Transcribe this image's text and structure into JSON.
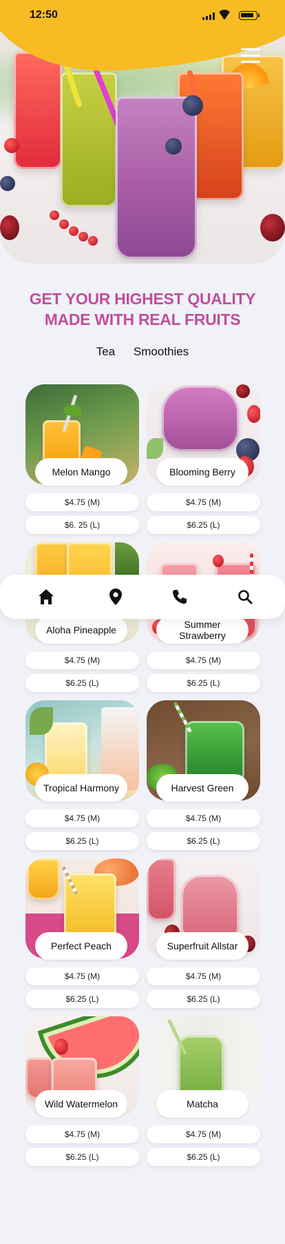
{
  "status_bar": {
    "time": "12:50"
  },
  "headline": {
    "line1": "GET YOUR HIGHEST QUALITY",
    "line2": "MADE WITH REAL FRUITS"
  },
  "categories": [
    "Tea",
    "Smoothies"
  ],
  "products": [
    {
      "name": "Melon Mango",
      "price_m": "$4.75 (M)",
      "price_l": "$6. 25 (L)"
    },
    {
      "name": "Blooming Berry",
      "price_m": "$4.75 (M)",
      "price_l": "$6.25 (L)"
    },
    {
      "name": "Aloha Pineapple",
      "price_m": "$4.75 (M)",
      "price_l": "$6.25 (L)"
    },
    {
      "name": "Summer Strawberry",
      "price_m": "$4.75 (M)",
      "price_l": "$6.25 (L)"
    },
    {
      "name": "Tropical Harmony",
      "price_m": "$4.75 (M)",
      "price_l": "$6.25 (L)"
    },
    {
      "name": "Harvest Green",
      "price_m": "$4.75 (M)",
      "price_l": "$6.25 (L)"
    },
    {
      "name": "Perfect Peach",
      "price_m": "$4.75 (M)",
      "price_l": "$6.25 (L)"
    },
    {
      "name": "Superfruit Allstar",
      "price_m": "$4.75 (M)",
      "price_l": "$6.25 (L)"
    },
    {
      "name": "Wild Watermelon",
      "price_m": "$4.75 (M)",
      "price_l": "$6.25 (L)"
    },
    {
      "name": "Matcha",
      "price_m": "$4.75 (M)",
      "price_l": "$6.25 (L)"
    }
  ],
  "bottom_nav": {
    "items": [
      {
        "icon": "home-icon"
      },
      {
        "icon": "location-pin-icon"
      },
      {
        "icon": "phone-icon"
      },
      {
        "icon": "search-icon"
      }
    ]
  },
  "colors": {
    "header_yellow": "#f8bb24",
    "headline_pink": "#c04f9c",
    "background": "#f1f1f8",
    "card_white": "#ffffff"
  }
}
